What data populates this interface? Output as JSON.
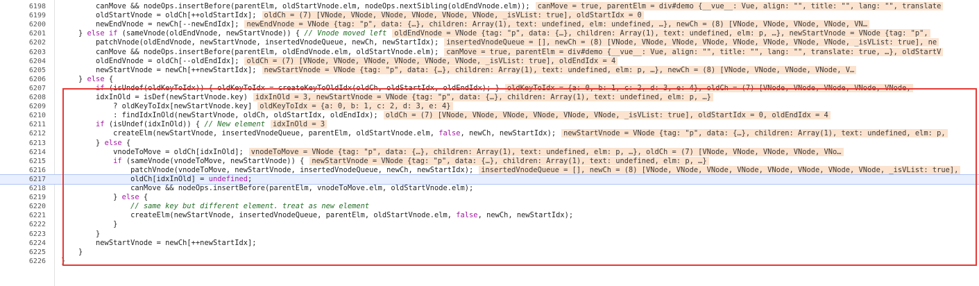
{
  "lines": [
    {
      "num": "6198",
      "indent": "    ",
      "code": "canMove && nodeOps.insertBefore(parentElm, oldStartVnode.elm, nodeOps.nextSibling(oldEndVnode.elm));",
      "inline": "canMove = true, parentElm = div#demo {__vue__: Vue, align: \"\", title: \"\", lang: \"\", translate"
    },
    {
      "num": "6199",
      "indent": "    ",
      "code": "oldStartVnode = oldCh[++oldStartIdx];",
      "inline": "oldCh = (7) [VNode, VNode, VNode, VNode, VNode, VNode, _isVList: true], oldStartIdx = 0"
    },
    {
      "num": "6200",
      "indent": "    ",
      "code": "newEndVnode = newCh[--newEndIdx];",
      "inline": "newEndVnode = VNode {tag: \"p\", data: {…}, children: Array(1), text: undefined, elm: undefined, …}, newCh = (8) [VNode, VNode, VNode, VNode, VN…"
    },
    {
      "num": "6201",
      "indent": "  ",
      "code": "} else if (sameVnode(oldEndVnode, newStartVnode)) { // Vnode moved left",
      "inline": "oldEndVnode = VNode {tag: \"p\", data: {…}, children: Array(1), text: undefined, elm: p, …}, newStartVnode = VNode {tag: \"p\","
    },
    {
      "num": "6202",
      "indent": "    ",
      "code": "patchVnode(oldEndVnode, newStartVnode, insertedVnodeQueue, newCh, newStartIdx);",
      "inline": "insertedVnodeQueue = [], newCh = (8) [VNode, VNode, VNode, VNode, VNode, VNode, VNode, VNode, _isVList: true], ne"
    },
    {
      "num": "6203",
      "indent": "    ",
      "code": "canMove && nodeOps.insertBefore(parentElm, oldEndVnode.elm, oldStartVnode.elm);",
      "inline": "canMove = true, parentElm = div#demo {__vue__: Vue, align: \"\", title: \"\", lang: \"\", translate: true, …}, oldStartV"
    },
    {
      "num": "6204",
      "indent": "    ",
      "code": "oldEndVnode = oldCh[--oldEndIdx];",
      "inline": "oldCh = (7) [VNode, VNode, VNode, VNode, VNode, VNode, _isVList: true], oldEndIdx = 4"
    },
    {
      "num": "6205",
      "indent": "    ",
      "code": "newStartVnode = newCh[++newStartIdx];",
      "inline": "newStartVnode = VNode {tag: \"p\", data: {…}, children: Array(1), text: undefined, elm: p, …}, newCh = (8) [VNode, VNode, VNode, VNode, V…"
    },
    {
      "num": "6206",
      "indent": "  ",
      "code": "} else {",
      "inline": ""
    },
    {
      "num": "6207",
      "indent": "    ",
      "code": "if (isUndef(oldKeyToIdx)) { oldKeyToIdx = createKeyToOldIdx(oldCh, oldStartIdx, oldEndIdx); }",
      "inline": "oldKeyToIdx = {a: 0, b: 1, c: 2, d: 3, e: 4}, oldCh = (7) [VNode, VNode, VNode, VNode, VNode,"
    },
    {
      "num": "6208",
      "indent": "    ",
      "code": "idxInOld = isDef(newStartVnode.key)",
      "inline": "idxInOld = 3, newStartVnode = VNode {tag: \"p\", data: {…}, children: Array(1), text: undefined, elm: p, …}"
    },
    {
      "num": "6209",
      "indent": "      ",
      "code": "? oldKeyToIdx[newStartVnode.key]",
      "inline": "oldKeyToIdx = {a: 0, b: 1, c: 2, d: 3, e: 4}"
    },
    {
      "num": "6210",
      "indent": "      ",
      "code": ": findIdxInOld(newStartVnode, oldCh, oldStartIdx, oldEndIdx);",
      "inline": "oldCh = (7) [VNode, VNode, VNode, VNode, VNode, VNode, _isVList: true], oldStartIdx = 0, oldEndIdx = 4"
    },
    {
      "num": "6211",
      "indent": "    ",
      "code": "if (isUndef(idxInOld)) { // New element",
      "inline": "idxInOld = 3"
    },
    {
      "num": "6212",
      "indent": "      ",
      "code": "createElm(newStartVnode, insertedVnodeQueue, parentElm, oldStartVnode.elm, false, newCh, newStartIdx);",
      "inline": "newStartVnode = VNode {tag: \"p\", data: {…}, children: Array(1), text: undefined, elm: p,"
    },
    {
      "num": "6213",
      "indent": "    ",
      "code": "} else {",
      "inline": ""
    },
    {
      "num": "6214",
      "indent": "      ",
      "code": "vnodeToMove = oldCh[idxInOld];",
      "inline": "vnodeToMove = VNode {tag: \"p\", data: {…}, children: Array(1), text: undefined, elm: p, …}, oldCh = (7) [VNode, VNode, VNode, VNode, VNo…"
    },
    {
      "num": "6215",
      "indent": "      ",
      "code": "if (sameVnode(vnodeToMove, newStartVnode)) {",
      "inline": "newStartVnode = VNode {tag: \"p\", data: {…}, children: Array(1), text: undefined, elm: p, …}"
    },
    {
      "num": "6216",
      "indent": "        ",
      "code": "patchVnode(vnodeToMove, newStartVnode, insertedVnodeQueue, newCh, newStartIdx);",
      "inline": "insertedVnodeQueue = [], newCh = (8) [VNode, VNode, VNode, VNode, VNode, VNode, VNode, VNode, _isVList: true],"
    },
    {
      "num": "6217",
      "indent": "        ",
      "code": "oldCh[idxInOld] = undefined;",
      "inline": ""
    },
    {
      "num": "6218",
      "indent": "        ",
      "code": "canMove && nodeOps.insertBefore(parentElm, vnodeToMove.elm, oldStartVnode.elm);",
      "inline": ""
    },
    {
      "num": "6219",
      "indent": "      ",
      "code": "} else {",
      "inline": ""
    },
    {
      "num": "6220",
      "indent": "        ",
      "code": "// same key but different element. treat as new element",
      "inline": ""
    },
    {
      "num": "6221",
      "indent": "        ",
      "code": "createElm(newStartVnode, insertedVnodeQueue, parentElm, oldStartVnode.elm, false, newCh, newStartIdx);",
      "inline": ""
    },
    {
      "num": "6222",
      "indent": "      ",
      "code": "}",
      "inline": ""
    },
    {
      "num": "6223",
      "indent": "    ",
      "code": "}",
      "inline": ""
    },
    {
      "num": "6224",
      "indent": "    ",
      "code": "newStartVnode = newCh[++newStartIdx];",
      "inline": ""
    },
    {
      "num": "6225",
      "indent": "  ",
      "code": "}",
      "inline": ""
    },
    {
      "num": "6226",
      "indent": "",
      "code": "}",
      "inline": ""
    }
  ],
  "current_line": "6217",
  "highlight_color": "#e53935"
}
